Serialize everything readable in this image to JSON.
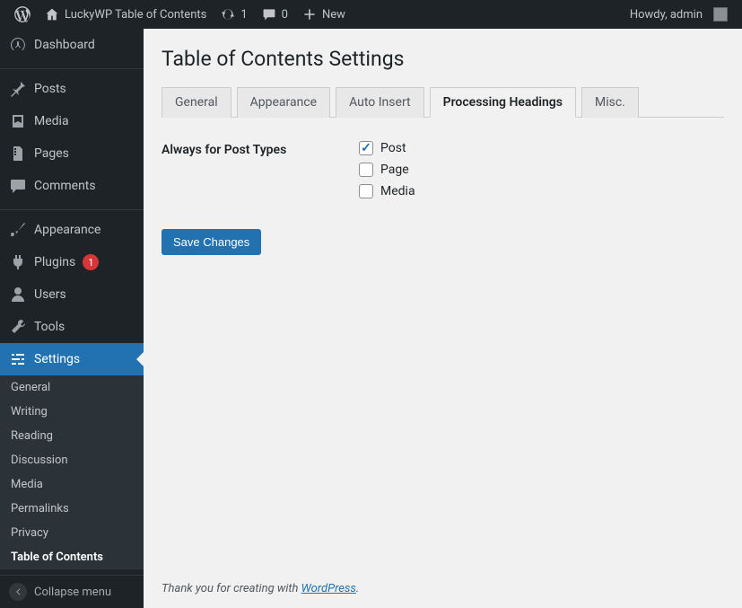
{
  "adminbar": {
    "site_name": "LuckyWP Table of Contents",
    "updates": "1",
    "comments": "0",
    "new": "New",
    "howdy": "Howdy, admin"
  },
  "sidebar": {
    "items": [
      {
        "label": "Dashboard"
      },
      {
        "label": "Posts"
      },
      {
        "label": "Media"
      },
      {
        "label": "Pages"
      },
      {
        "label": "Comments"
      },
      {
        "label": "Appearance"
      },
      {
        "label": "Plugins",
        "badge": "1"
      },
      {
        "label": "Users"
      },
      {
        "label": "Tools"
      },
      {
        "label": "Settings"
      }
    ],
    "submenu": [
      {
        "label": "General"
      },
      {
        "label": "Writing"
      },
      {
        "label": "Reading"
      },
      {
        "label": "Discussion"
      },
      {
        "label": "Media"
      },
      {
        "label": "Permalinks"
      },
      {
        "label": "Privacy"
      },
      {
        "label": "Table of Contents"
      }
    ],
    "collapse": "Collapse menu"
  },
  "page": {
    "title": "Table of Contents Settings",
    "tabs": [
      {
        "label": "General"
      },
      {
        "label": "Appearance"
      },
      {
        "label": "Auto Insert"
      },
      {
        "label": "Processing Headings"
      },
      {
        "label": "Misc."
      }
    ],
    "field_label": "Always for Post Types",
    "checkboxes": [
      {
        "label": "Post",
        "checked": true
      },
      {
        "label": "Page",
        "checked": false
      },
      {
        "label": "Media",
        "checked": false
      }
    ],
    "save": "Save Changes"
  },
  "footer": {
    "text_before": "Thank you for creating with ",
    "link": "WordPress",
    "text_after": "."
  }
}
